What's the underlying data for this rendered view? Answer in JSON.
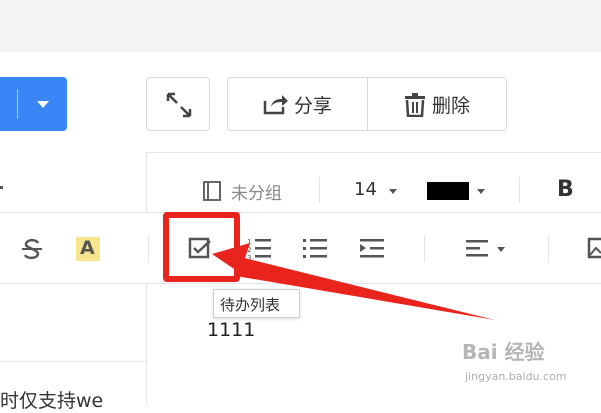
{
  "header": {
    "share_label": "分享",
    "delete_label": "删除"
  },
  "meta": {
    "group_label": "未分组",
    "font_size": "14",
    "font_color": "#000000",
    "bold_label": "B"
  },
  "format_toolbar": {
    "highlight_label": "A",
    "tooltip": "待办列表"
  },
  "editor": {
    "body_text": "1111"
  },
  "left_panel": {
    "snippet": "时仅支持we"
  },
  "annotation": {
    "color": "#e8241c"
  },
  "watermark": {
    "line1": "Bai 经验",
    "line2": "jingyan.baidu.com"
  },
  "colors": {
    "accent": "#3a86f7"
  }
}
